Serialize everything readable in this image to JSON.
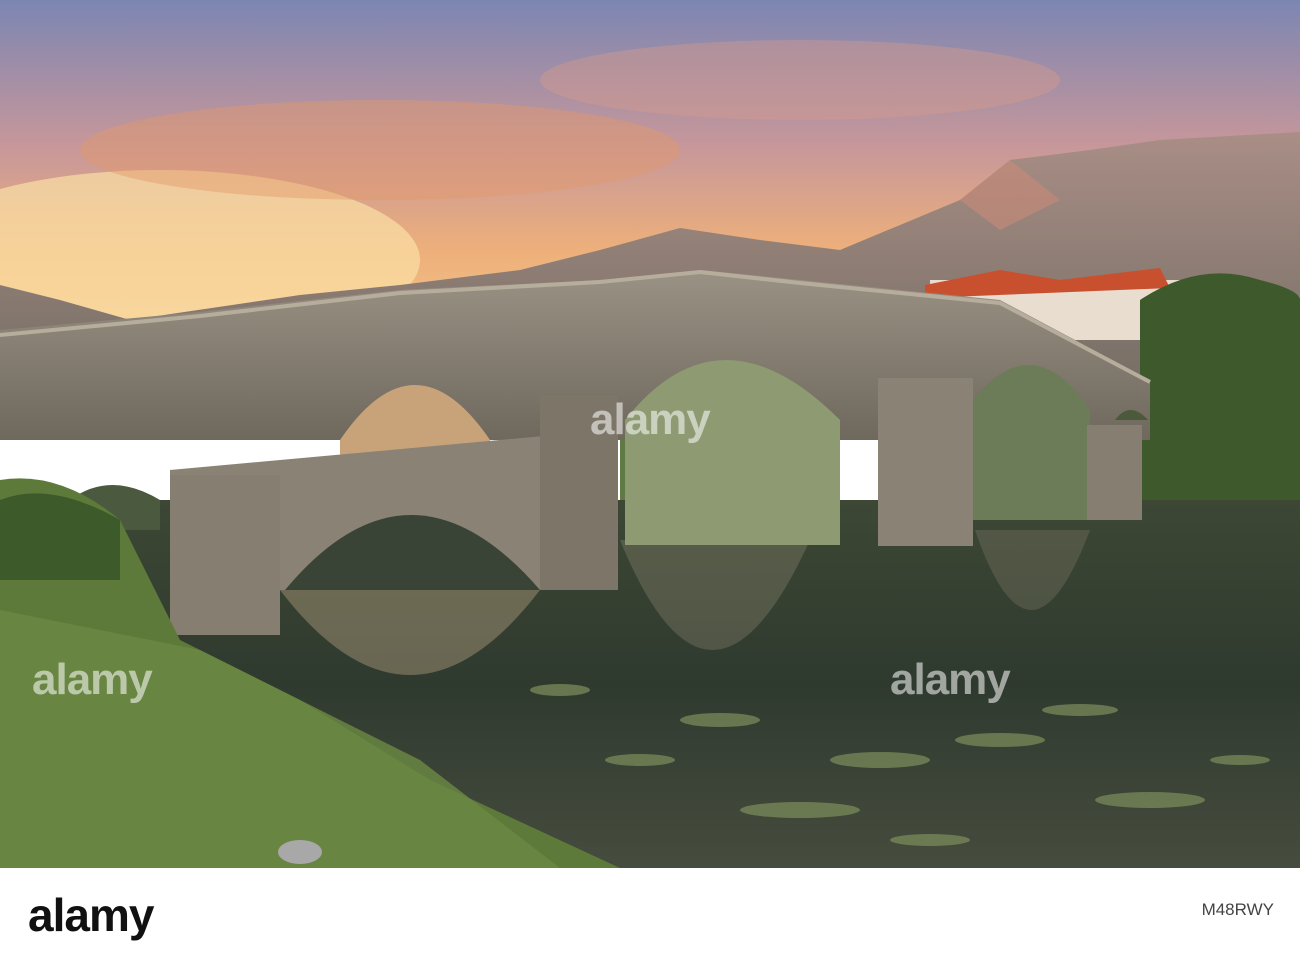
{
  "watermark": {
    "text": "alamy"
  },
  "footer": {
    "brand": "alamy",
    "image_id": "M48RWY"
  },
  "colors": {
    "sky_orange": "#f2a65a",
    "sky_blue": "#6f86b8",
    "stone": "#8a8274",
    "water": "#3f4a38",
    "grass": "#5d7a3a",
    "roof": "#c9502f"
  }
}
